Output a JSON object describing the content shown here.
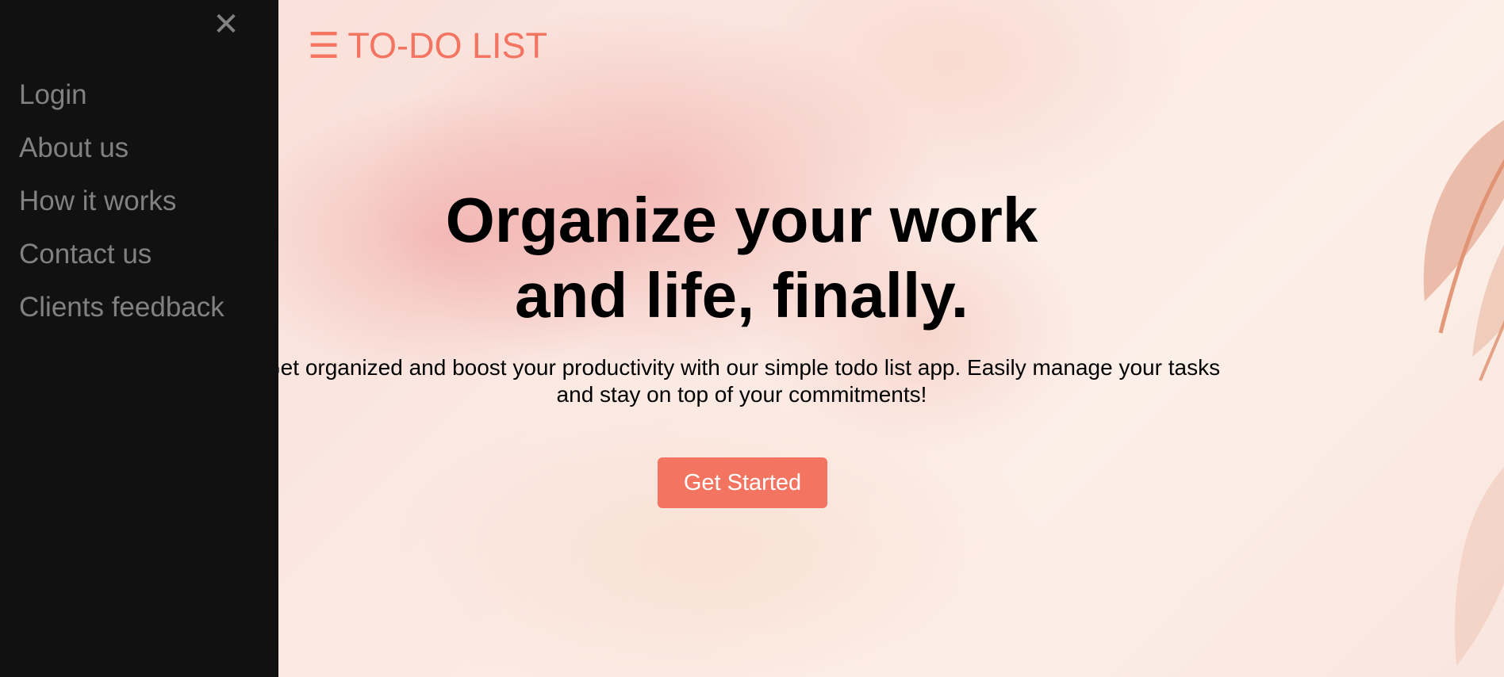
{
  "sidebar": {
    "close_icon": "close-icon",
    "close_glyph": "✕",
    "items": [
      {
        "label": "Login"
      },
      {
        "label": "About us"
      },
      {
        "label": "How it works"
      },
      {
        "label": "Contact us"
      },
      {
        "label": "Clients feedback"
      }
    ]
  },
  "header": {
    "menu_icon": "hamburger-icon",
    "menu_glyph": "☰",
    "brand": "TO-DO LIST"
  },
  "hero": {
    "title_line1": "Organize your work",
    "title_line2": "and life, finally.",
    "description_line1": "Get organized and boost your productivity with our simple todo list app. Easily manage your tasks",
    "description_line2": "and stay on top of your commitments!",
    "cta_label": "Get Started"
  },
  "colors": {
    "accent": "#f47462",
    "sidebar_bg": "#111111",
    "sidebar_text": "#818181"
  }
}
